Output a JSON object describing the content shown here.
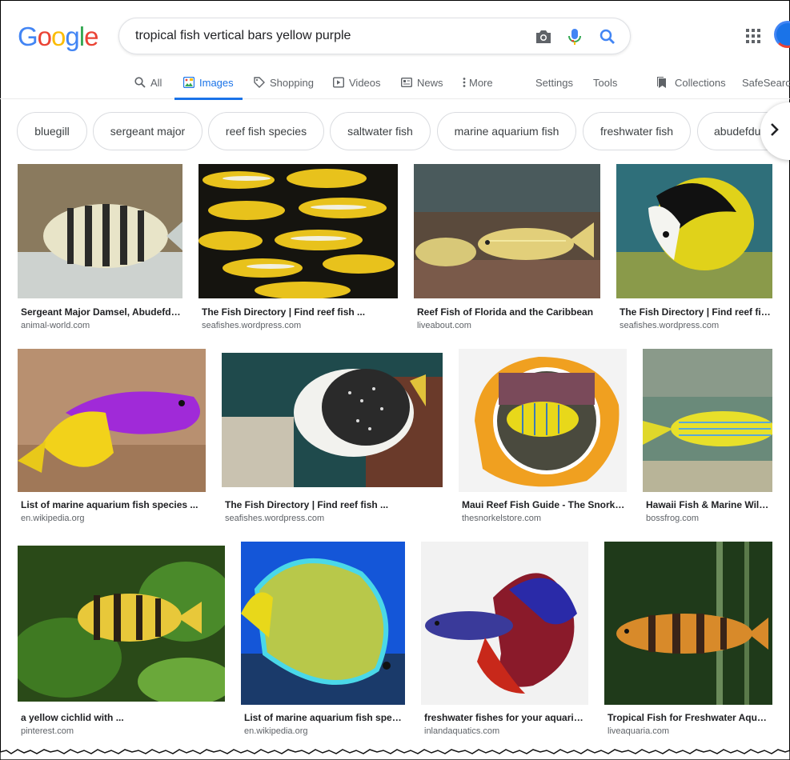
{
  "logo": [
    "G",
    "o",
    "o",
    "g",
    "l",
    "e"
  ],
  "logo_colors": [
    "#4285f4",
    "#ea4335",
    "#fbbc05",
    "#4285f4",
    "#34a853",
    "#ea4335"
  ],
  "search": {
    "query": "tropical fish vertical bars yellow purple"
  },
  "tabs": [
    {
      "label": "All",
      "icon": "search-icon"
    },
    {
      "label": "Images",
      "icon": "image-icon"
    },
    {
      "label": "Shopping",
      "icon": "tag-icon"
    },
    {
      "label": "Videos",
      "icon": "play-icon"
    },
    {
      "label": "News",
      "icon": "news-icon"
    },
    {
      "label": "More",
      "icon": "more-vert-icon"
    },
    {
      "label": "Settings"
    },
    {
      "label": "Tools"
    },
    {
      "label": "Collections",
      "icon": "bookmark-icon"
    },
    {
      "label": "SafeSearch"
    }
  ],
  "chips": [
    "bluegill",
    "sergeant major",
    "reef fish species",
    "saltwater fish",
    "marine aquarium fish",
    "freshwater fish",
    "abudefdu"
  ],
  "results": [
    {
      "title": "Sergeant Major Damsel, Abudefduf saxatilis",
      "source": "animal-world.com"
    },
    {
      "title": "The Fish Directory | Find reef fish ...",
      "source": "seafishes.wordpress.com"
    },
    {
      "title": "Reef Fish of Florida and the Caribbean",
      "source": "liveabout.com"
    },
    {
      "title": "The Fish Directory | Find reef fish ...",
      "source": "seafishes.wordpress.com"
    },
    {
      "title": "List of marine aquarium fish species ...",
      "source": "en.wikipedia.org"
    },
    {
      "title": "The Fish Directory | Find reef fish ...",
      "source": "seafishes.wordpress.com"
    },
    {
      "title": "Maui Reef Fish Guide - The Snorkel Store",
      "source": "thesnorkelstore.com"
    },
    {
      "title": "Hawaii Fish & Marine Wildlife",
      "source": "bossfrog.com"
    },
    {
      "title": "a yellow cichlid with ...",
      "source": "pinterest.com"
    },
    {
      "title": "List of marine aquarium fish species ...",
      "source": "en.wikipedia.org"
    },
    {
      "title": "freshwater fishes for your aquarium ...",
      "source": "inlandaquatics.com"
    },
    {
      "title": "Tropical Fish for Freshwater Aquariums",
      "source": "liveaquaria.com"
    }
  ]
}
